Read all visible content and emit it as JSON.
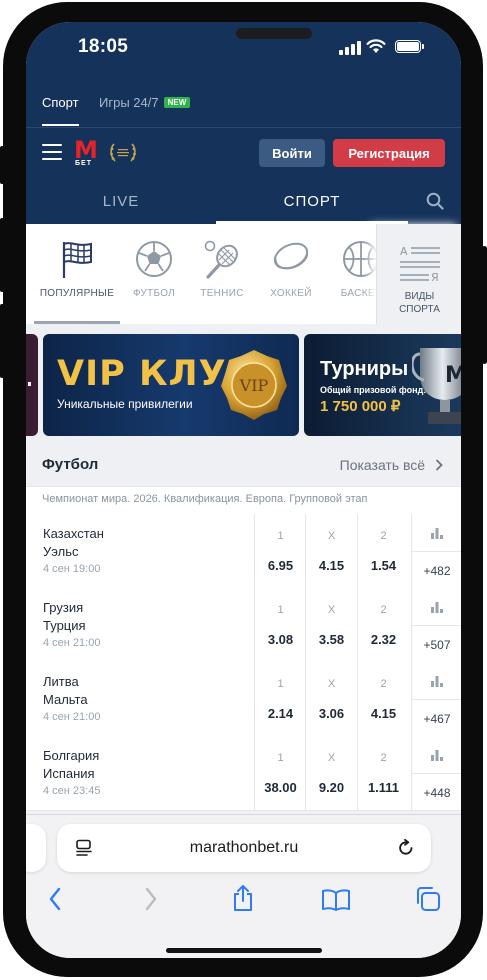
{
  "status_bar": {
    "time": "18:05"
  },
  "top_tabs": {
    "sport": "Спорт",
    "games": "Игры 24/7",
    "games_badge": "NEW"
  },
  "header": {
    "logo_letter": "M",
    "logo_text": "БЕТ",
    "login": "Войти",
    "register": "Регистрация"
  },
  "main_nav": {
    "live": "LIVE",
    "sport": "СПОРТ"
  },
  "categories": [
    {
      "label": "ПОПУЛЯРНЫЕ",
      "icon": "flag-icon"
    },
    {
      "label": "ФУТБОЛ",
      "icon": "soccer-ball-icon"
    },
    {
      "label": "ТЕННИС",
      "icon": "tennis-racket-icon"
    },
    {
      "label": "ХОККЕЙ",
      "icon": "hockey-puck-icon"
    },
    {
      "label": "БАСКЕТ",
      "icon": "basketball-icon"
    }
  ],
  "sport_types": {
    "label_line1": "ВИДЫ",
    "label_line2": "СПОРТА",
    "icon": "list-icon"
  },
  "banners": {
    "vip_title": "VIP КЛУБ",
    "vip_subtitle": "Уникальные привилегии",
    "vip_coin": "VIP",
    "tour_title": "Турниры",
    "tour_subtitle": "Общий призовой фонд:",
    "tour_prize": "1 750 000 ₽",
    "tour_cup_letter": "M"
  },
  "football": {
    "title": "Футбол",
    "show_all": "Показать всё",
    "league": "Чемпионат мира. 2026. Квалификация. Европа. Групповой этап",
    "headers": [
      "1",
      "X",
      "2"
    ],
    "matches": [
      {
        "team1": "Казахстан",
        "team2": "Уэльс",
        "date": "4 сен 19:00",
        "odds": [
          "6.95",
          "4.15",
          "1.54"
        ],
        "more": "+482"
      },
      {
        "team1": "Грузия",
        "team2": "Турция",
        "date": "4 сен 21:00",
        "odds": [
          "3.08",
          "3.58",
          "2.32"
        ],
        "more": "+507"
      },
      {
        "team1": "Литва",
        "team2": "Мальта",
        "date": "4 сен 21:00",
        "odds": [
          "2.14",
          "3.06",
          "4.15"
        ],
        "more": "+467"
      },
      {
        "team1": "Болгария",
        "team2": "Испания",
        "date": "4 сен 23:45",
        "odds": [
          "38.00",
          "9.20",
          "1.111"
        ],
        "more": "+448"
      }
    ]
  },
  "browser": {
    "url": "marathonbet.ru"
  }
}
